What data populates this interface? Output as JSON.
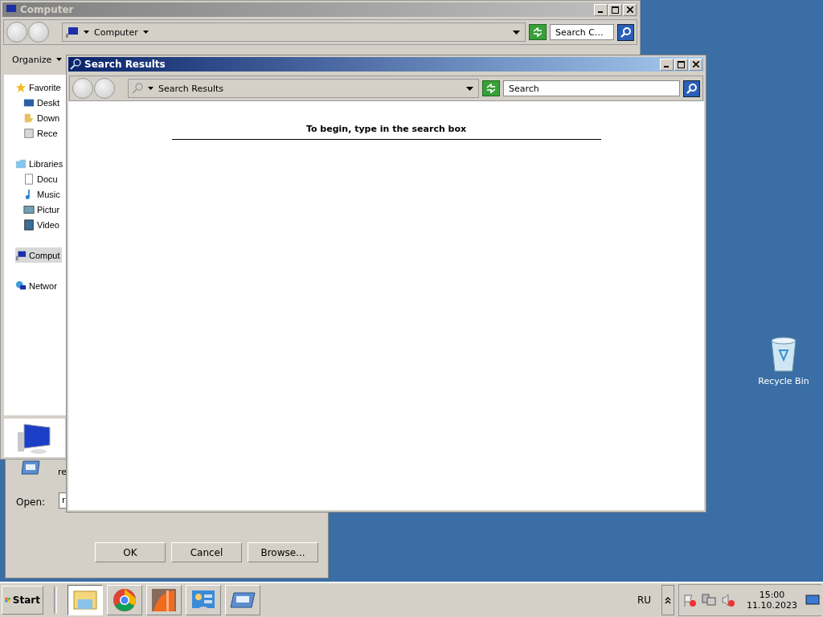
{
  "desktop": {
    "icons": [
      {
        "label": "Recycle Bin"
      }
    ]
  },
  "run_dialog": {
    "description": "re",
    "open_label": "Open:",
    "open_value": "r",
    "buttons": [
      "OK",
      "Cancel",
      "Browse..."
    ]
  },
  "explorer": {
    "title": "Computer",
    "address": "Computer",
    "search": {
      "placeholder": "Search C..."
    },
    "toolbar": [
      "Organize"
    ],
    "nav": [
      {
        "label": "Favorite",
        "kind": "star",
        "selected": false,
        "children": [
          {
            "label": "Deskt",
            "kind": "desktop",
            "selected": false
          },
          {
            "label": "Down",
            "kind": "download",
            "selected": false
          },
          {
            "label": "Rece",
            "kind": "recent",
            "selected": false
          }
        ]
      },
      {
        "label": "Libraries",
        "kind": "library",
        "selected": false,
        "children": [
          {
            "label": "Docu",
            "kind": "document",
            "selected": false
          },
          {
            "label": "Music",
            "kind": "music",
            "selected": false
          },
          {
            "label": "Pictur",
            "kind": "picture",
            "selected": false
          },
          {
            "label": "Video",
            "kind": "video",
            "selected": false
          }
        ]
      },
      {
        "label": "Comput",
        "kind": "computer",
        "selected": true
      },
      {
        "label": "Networ",
        "kind": "network",
        "selected": false
      }
    ]
  },
  "search_window": {
    "title": "Search Results",
    "address": "Search Results",
    "search": {
      "placeholder": "Search"
    },
    "message": "To begin, type in the search box"
  },
  "taskbar": {
    "start": "Start",
    "apps": [
      {
        "kind": "explorer",
        "selected": true
      },
      {
        "kind": "chrome",
        "selected": false
      },
      {
        "kind": "orange",
        "selected": false
      },
      {
        "kind": "control",
        "selected": false
      },
      {
        "kind": "run",
        "selected": false
      }
    ],
    "language": "RU",
    "time": "15:00",
    "date": "11.10.2023"
  }
}
